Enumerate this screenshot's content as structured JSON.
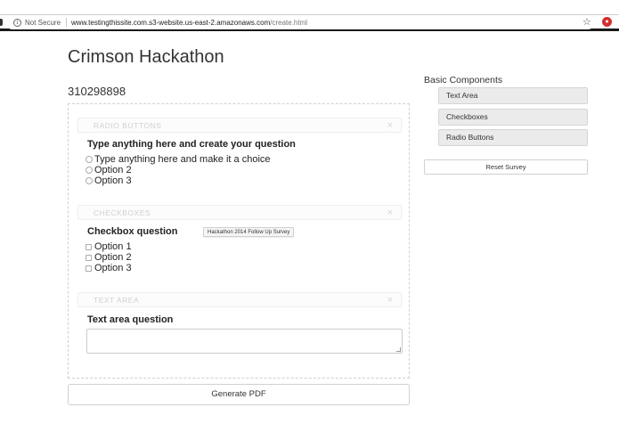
{
  "browser": {
    "security_label": "Not Secure",
    "url_host": "www.testingthissite.com.s3-website.us-east-2.amazonaws.com",
    "url_path": "/create.html",
    "bookmark_icon": "star-icon",
    "extension_icon": "extension-icon"
  },
  "page": {
    "title": "Crimson Hackathon",
    "survey_id": "310298898"
  },
  "components": {
    "radio": {
      "header": "RADIO BUTTONS",
      "question": "Type anything here and create your question",
      "options": [
        "Type anything here and make it a choice",
        "Option 2",
        "Option 3"
      ]
    },
    "checkbox": {
      "header": "CHECKBOXES",
      "question": "Checkbox question",
      "options": [
        "Option 1",
        "Option 2",
        "Option 3"
      ]
    },
    "textarea": {
      "header": "TEXT AREA",
      "question": "Text area question",
      "value": ""
    }
  },
  "tooltip": "Hackathon 2014 Follow Up Survey",
  "actions": {
    "generate_pdf": "Generate PDF",
    "reset_survey": "Reset Survey"
  },
  "sidebar": {
    "title": "Basic Components",
    "items": [
      "Text Area",
      "Checkboxes",
      "Radio Buttons"
    ]
  },
  "colors": {
    "security_badge": "#d32f2f",
    "button_bg": "#ebebeb",
    "dashed_border": "#cfcfcf"
  }
}
